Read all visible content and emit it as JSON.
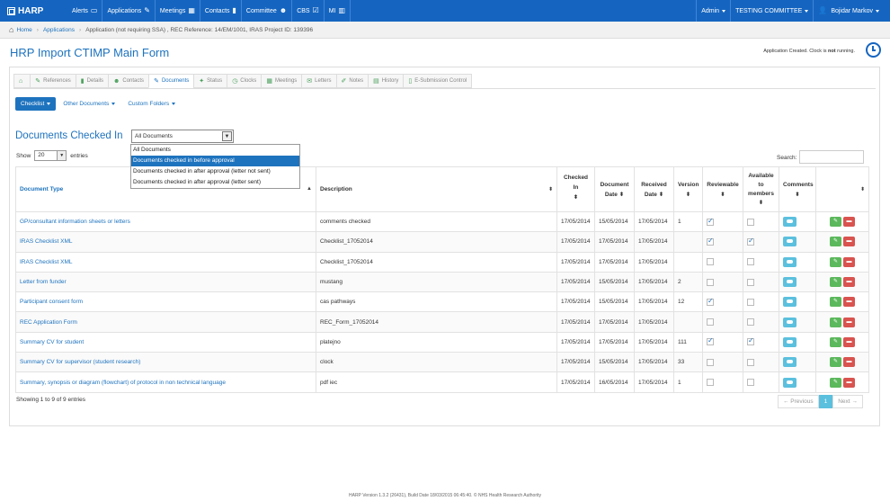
{
  "navbar": {
    "brand": "HARP",
    "items": [
      {
        "label": "Alerts",
        "icon": "monitor-icon"
      },
      {
        "label": "Applications",
        "icon": "edit-icon"
      },
      {
        "label": "Meetings",
        "icon": "calendar-icon"
      },
      {
        "label": "Contacts",
        "icon": "book-icon"
      },
      {
        "label": "Committee",
        "icon": "group-icon"
      },
      {
        "label": "CBS",
        "icon": "checkbox-icon"
      },
      {
        "label": "MI",
        "icon": "chart-icon"
      }
    ],
    "admin": "Admin",
    "committee": "TESTING COMMITTEE",
    "user": "Bojidar Markov"
  },
  "breadcrumb": {
    "home": "Home",
    "applications": "Applications",
    "current": "Application (not requiring SSA) , REC Reference: 14/EM/1001, IRAS Project ID: 139396"
  },
  "page": {
    "title": "HRP Import CTIMP Main Form",
    "status_prefix": "Application Created. Clock is ",
    "status_bold": "not",
    "status_suffix": " running."
  },
  "tabs": [
    {
      "label": "",
      "icon": "home-icon"
    },
    {
      "label": "References",
      "icon": "edit-icon"
    },
    {
      "label": "Details",
      "icon": "book-icon"
    },
    {
      "label": "Contacts",
      "icon": "group-icon"
    },
    {
      "label": "Documents",
      "icon": "paperclip-icon",
      "active": true
    },
    {
      "label": "Status",
      "icon": "wrench-icon"
    },
    {
      "label": "Clocks",
      "icon": "clock-icon"
    },
    {
      "label": "Meetings",
      "icon": "calendar-icon"
    },
    {
      "label": "Letters",
      "icon": "envelope-icon"
    },
    {
      "label": "Notes",
      "icon": "pencil-icon"
    },
    {
      "label": "History",
      "icon": "list-icon"
    },
    {
      "label": "E-Submission Control",
      "icon": "file-icon"
    }
  ],
  "subnav": {
    "checklist": "Checklist",
    "other_documents": "Other Documents",
    "custom_folders": "Custom Folders"
  },
  "checked_in": {
    "heading": "Documents Checked In",
    "selected": "All Documents",
    "options": [
      "All Documents",
      "Documents checked in before approval",
      "Documents checked in after approval (letter not sent)",
      "Documents checked in after approval (letter sent)"
    ],
    "highlighted_option": 1
  },
  "table_controls": {
    "show": "Show",
    "page_size": "20",
    "entries": "entries",
    "search": "Search:"
  },
  "table": {
    "headers": [
      "Document Type",
      "Description",
      "Checked In",
      "Document Date",
      "Received Date",
      "Version",
      "Reviewable",
      "Available to members",
      "Comments",
      ""
    ],
    "rows": [
      {
        "type": "GP/consultant information sheets or letters",
        "description": "comments checked",
        "checked_in": "17/05/2014",
        "doc_date": "15/05/2014",
        "received": "17/05/2014",
        "version": "1",
        "reviewable": true,
        "available": false
      },
      {
        "type": "IRAS Checklist XML",
        "description": "Checklist_17052014",
        "checked_in": "17/05/2014",
        "doc_date": "17/05/2014",
        "received": "17/05/2014",
        "version": "",
        "reviewable": true,
        "available": true
      },
      {
        "type": "IRAS Checklist XML",
        "description": "Checklist_17052014",
        "checked_in": "17/05/2014",
        "doc_date": "17/05/2014",
        "received": "17/05/2014",
        "version": "",
        "reviewable": false,
        "available": false
      },
      {
        "type": "Letter from funder",
        "description": "mustang",
        "checked_in": "17/05/2014",
        "doc_date": "15/05/2014",
        "received": "17/05/2014",
        "version": "2",
        "reviewable": false,
        "available": false
      },
      {
        "type": "Participant consent form",
        "description": "cas pathways",
        "checked_in": "17/05/2014",
        "doc_date": "15/05/2014",
        "received": "17/05/2014",
        "version": "12",
        "reviewable": true,
        "available": false
      },
      {
        "type": "REC Application Form",
        "description": "REC_Form_17052014",
        "checked_in": "17/05/2014",
        "doc_date": "17/05/2014",
        "received": "17/05/2014",
        "version": "",
        "reviewable": false,
        "available": false
      },
      {
        "type": "Summary CV for student",
        "description": "platejno",
        "checked_in": "17/05/2014",
        "doc_date": "17/05/2014",
        "received": "17/05/2014",
        "version": "111",
        "reviewable": true,
        "available": true
      },
      {
        "type": "Summary CV for supervisor (student research)",
        "description": "clock",
        "checked_in": "17/05/2014",
        "doc_date": "15/05/2014",
        "received": "17/05/2014",
        "version": "33",
        "reviewable": false,
        "available": false
      },
      {
        "type": "Summary, synopsis or diagram (flowchart) of protocol in non technical language",
        "description": "pdf iec",
        "checked_in": "17/05/2014",
        "doc_date": "16/05/2014",
        "received": "17/05/2014",
        "version": "1",
        "reviewable": false,
        "available": false
      }
    ]
  },
  "pagination": {
    "showing": "Showing 1 to 9 of 9 entries",
    "previous": "← Previous",
    "page": "1",
    "next": "Next →"
  },
  "footer": "HARP Version 1.3.2 (26431), Build Date 18/03/2015 06:45:40. © NHS Health Research Authority",
  "colors": {
    "brand_blue": "#1565c0",
    "link_blue": "#1e73be",
    "info": "#5bc0de",
    "success": "#5cb85c",
    "danger": "#d9534f"
  }
}
